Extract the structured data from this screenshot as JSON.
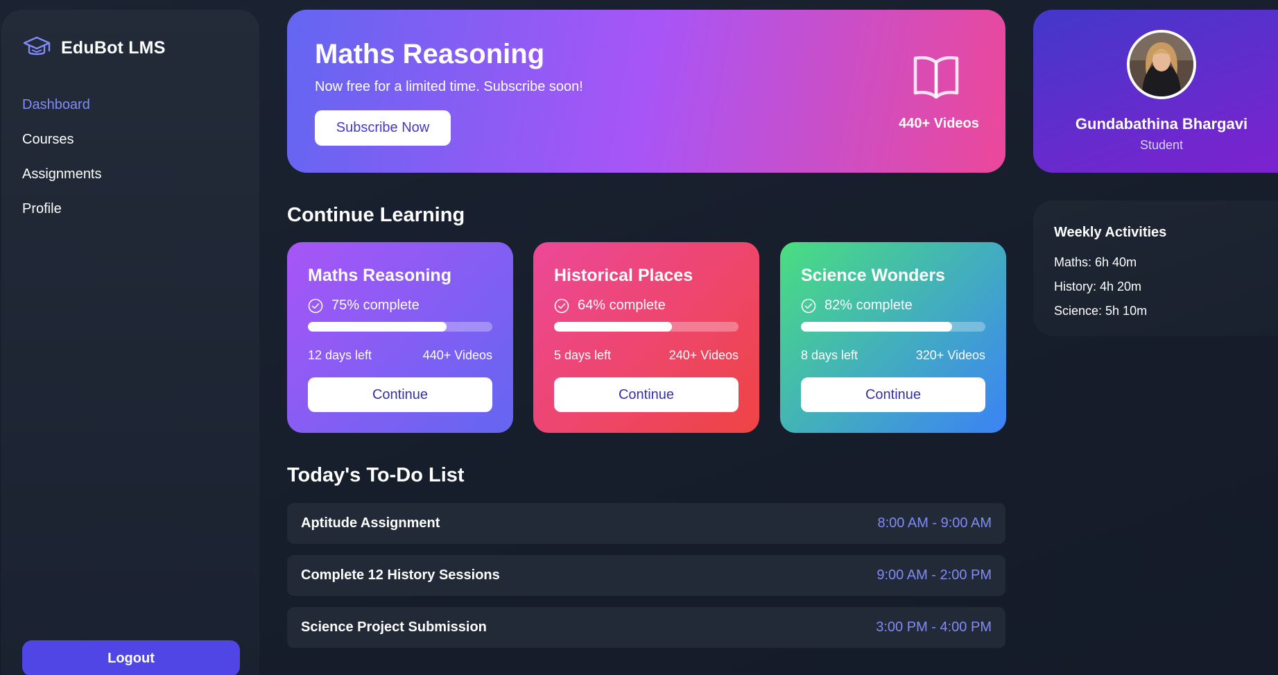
{
  "sidebar": {
    "brand": "EduBot LMS",
    "brand_icon": "graduation-cap-icon",
    "nav": [
      {
        "label": "Dashboard",
        "active": true
      },
      {
        "label": "Courses",
        "active": false
      },
      {
        "label": "Assignments",
        "active": false
      },
      {
        "label": "Profile",
        "active": false
      }
    ],
    "logout_label": "Logout"
  },
  "hero": {
    "title": "Maths Reasoning",
    "subtitle": "Now free for a limited time. Subscribe soon!",
    "button_label": "Subscribe Now",
    "icon": "open-book-icon",
    "videos": "440+ Videos"
  },
  "continue_learning": {
    "title": "Continue Learning",
    "courses": [
      {
        "title": "Maths Reasoning",
        "progress_text": "75% complete",
        "progress": 0.75,
        "days_left": "12 days left",
        "videos": "440+ Videos",
        "button_label": "Continue"
      },
      {
        "title": "Historical Places",
        "progress_text": "64% complete",
        "progress": 0.64,
        "days_left": "5 days left",
        "videos": "240+ Videos",
        "button_label": "Continue"
      },
      {
        "title": "Science Wonders",
        "progress_text": "82% complete",
        "progress": 0.82,
        "days_left": "8 days left",
        "videos": "320+ Videos",
        "button_label": "Continue"
      }
    ]
  },
  "todo": {
    "title": "Today's To-Do List",
    "items": [
      {
        "task": "Aptitude Assignment",
        "time": "8:00 AM - 9:00 AM"
      },
      {
        "task": "Complete 12 History Sessions",
        "time": "9:00 AM - 2:00 PM"
      },
      {
        "task": "Science Project Submission",
        "time": "3:00 PM - 4:00 PM"
      }
    ]
  },
  "profile": {
    "name": "Gundabathina Bhargavi",
    "role": "Student"
  },
  "weekly": {
    "title": "Weekly Activities",
    "items": [
      "Maths: 6h 40m",
      "History: 4h 20m",
      "Science: 5h 10m"
    ]
  },
  "colors": {
    "accent": "#818cf8",
    "logout_bg": "#4f46e5",
    "background": "#161d2b"
  }
}
